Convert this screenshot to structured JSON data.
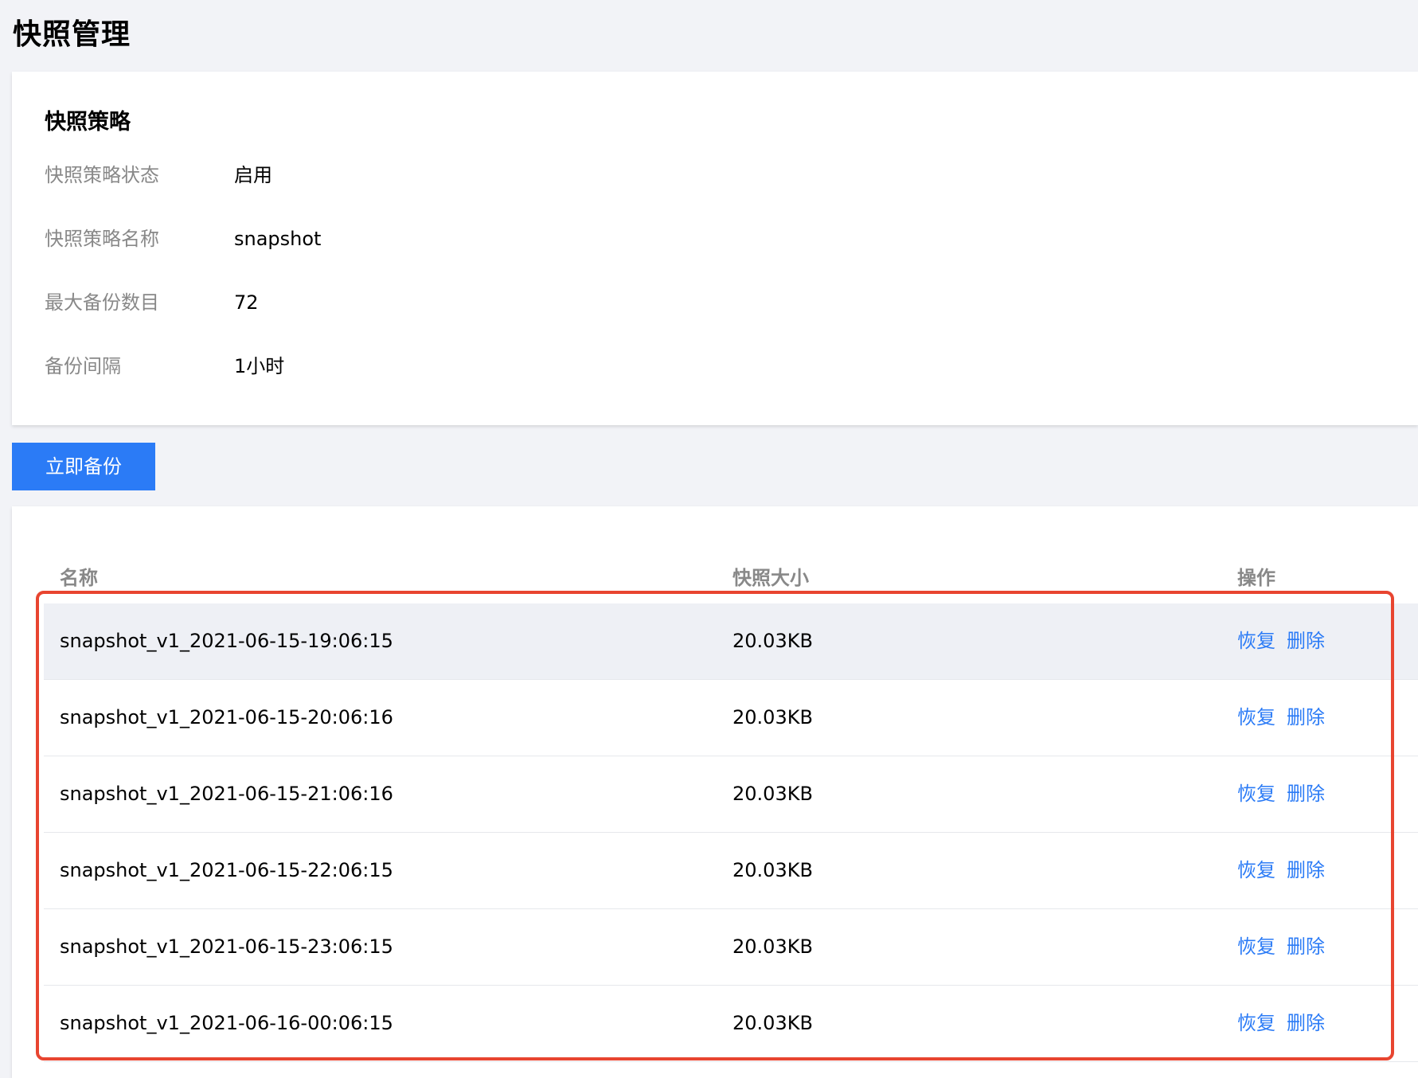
{
  "page": {
    "title": "快照管理"
  },
  "policy": {
    "title": "快照策略",
    "fields": [
      {
        "label": "快照策略状态",
        "value": "启用"
      },
      {
        "label": "快照策略名称",
        "value": "snapshot"
      },
      {
        "label": "最大备份数目",
        "value": "72"
      },
      {
        "label": "备份间隔",
        "value": "1小时"
      }
    ]
  },
  "actions": {
    "backup_now": "立即备份"
  },
  "table": {
    "columns": {
      "name": "名称",
      "size": "快照大小",
      "ops": "操作"
    },
    "rows": [
      {
        "name": "snapshot_v1_2021-06-15-19:06:15",
        "size": "20.03KB",
        "restore": "恢复",
        "delete": "删除"
      },
      {
        "name": "snapshot_v1_2021-06-15-20:06:16",
        "size": "20.03KB",
        "restore": "恢复",
        "delete": "删除"
      },
      {
        "name": "snapshot_v1_2021-06-15-21:06:16",
        "size": "20.03KB",
        "restore": "恢复",
        "delete": "删除"
      },
      {
        "name": "snapshot_v1_2021-06-15-22:06:15",
        "size": "20.03KB",
        "restore": "恢复",
        "delete": "删除"
      },
      {
        "name": "snapshot_v1_2021-06-15-23:06:15",
        "size": "20.03KB",
        "restore": "恢复",
        "delete": "删除"
      },
      {
        "name": "snapshot_v1_2021-06-16-00:06:15",
        "size": "20.03KB",
        "restore": "恢复",
        "delete": "删除"
      }
    ]
  },
  "colors": {
    "accent": "#2b7bf6",
    "highlight": "#e84530",
    "background": "#f2f3f7"
  }
}
